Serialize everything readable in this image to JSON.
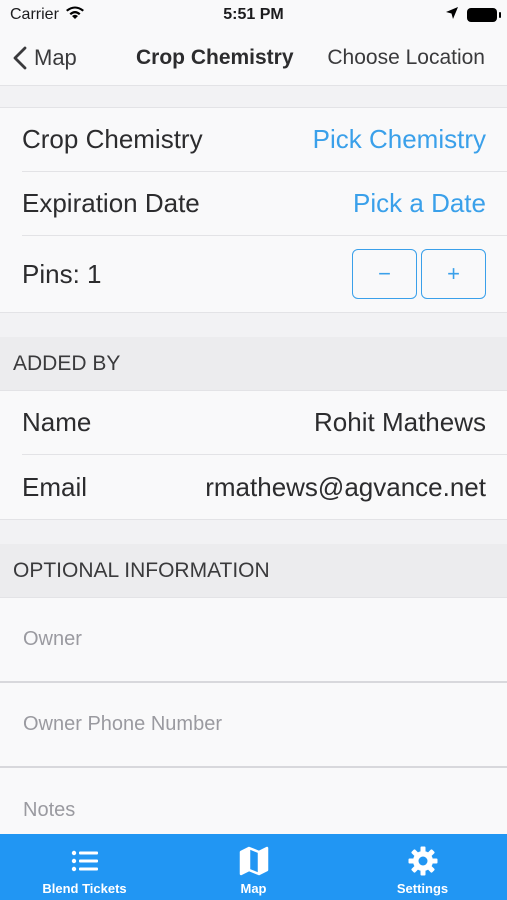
{
  "status": {
    "carrier": "Carrier",
    "time": "5:51 PM"
  },
  "nav": {
    "back_label": "Map",
    "title": "Crop Chemistry",
    "right_action": "Choose Location"
  },
  "details": {
    "crop_chemistry_label": "Crop Chemistry",
    "crop_chemistry_value": "Pick Chemistry",
    "expiration_label": "Expiration Date",
    "expiration_value": "Pick a Date",
    "pins_label": "Pins: 1",
    "minus": "−",
    "plus": "+"
  },
  "added_by": {
    "header": "ADDED BY",
    "name_label": "Name",
    "name_value": "Rohit Mathews",
    "email_label": "Email",
    "email_value": "rmathews@agvance.net"
  },
  "optional": {
    "header": "OPTIONAL INFORMATION",
    "owner_placeholder": "Owner",
    "owner_phone_placeholder": "Owner Phone Number",
    "notes_placeholder": "Notes"
  },
  "tabs": [
    {
      "label": "Blend Tickets",
      "icon": "list-icon"
    },
    {
      "label": "Map",
      "icon": "map-icon"
    },
    {
      "label": "Settings",
      "icon": "gear-icon"
    }
  ],
  "colors": {
    "accent": "#3aa0ea",
    "tab_bar": "#2196f3"
  }
}
